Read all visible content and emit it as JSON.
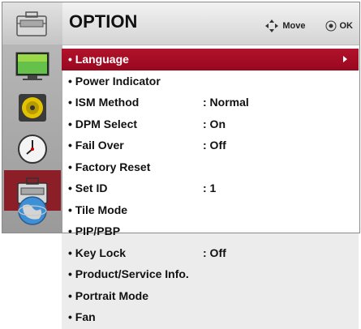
{
  "header": {
    "title": "OPTION",
    "move_label": "Move",
    "ok_label": "OK"
  },
  "sidebar": {
    "items": [
      {
        "icon": "picture-icon"
      },
      {
        "icon": "audio-speaker-icon"
      },
      {
        "icon": "clock-icon"
      },
      {
        "icon": "option-toolbox-icon",
        "active": true
      },
      {
        "icon": "globe-icon"
      }
    ]
  },
  "menu": {
    "items": [
      {
        "label": "• Language",
        "value": ""
      },
      {
        "label": "• Power Indicator",
        "value": ""
      },
      {
        "label": "• ISM Method",
        "value": ": Normal"
      },
      {
        "label": "• DPM Select",
        "value": ": On"
      },
      {
        "label": "• Fail Over",
        "value": ": Off"
      },
      {
        "label": "• Factory Reset",
        "value": ""
      },
      {
        "label": "• Set ID",
        "value": ": 1"
      },
      {
        "label": "• Tile Mode",
        "value": ""
      },
      {
        "label": "• PIP/PBP",
        "value": ""
      },
      {
        "label": "• Key Lock",
        "value": ": Off"
      },
      {
        "label": "• Product/Service Info.",
        "value": ""
      },
      {
        "label": "• Portrait Mode",
        "value": ""
      },
      {
        "label": "• Fan",
        "value": ""
      }
    ]
  },
  "colors": {
    "selected": "#a60e26",
    "sidebar_active": "#8c1e28"
  }
}
